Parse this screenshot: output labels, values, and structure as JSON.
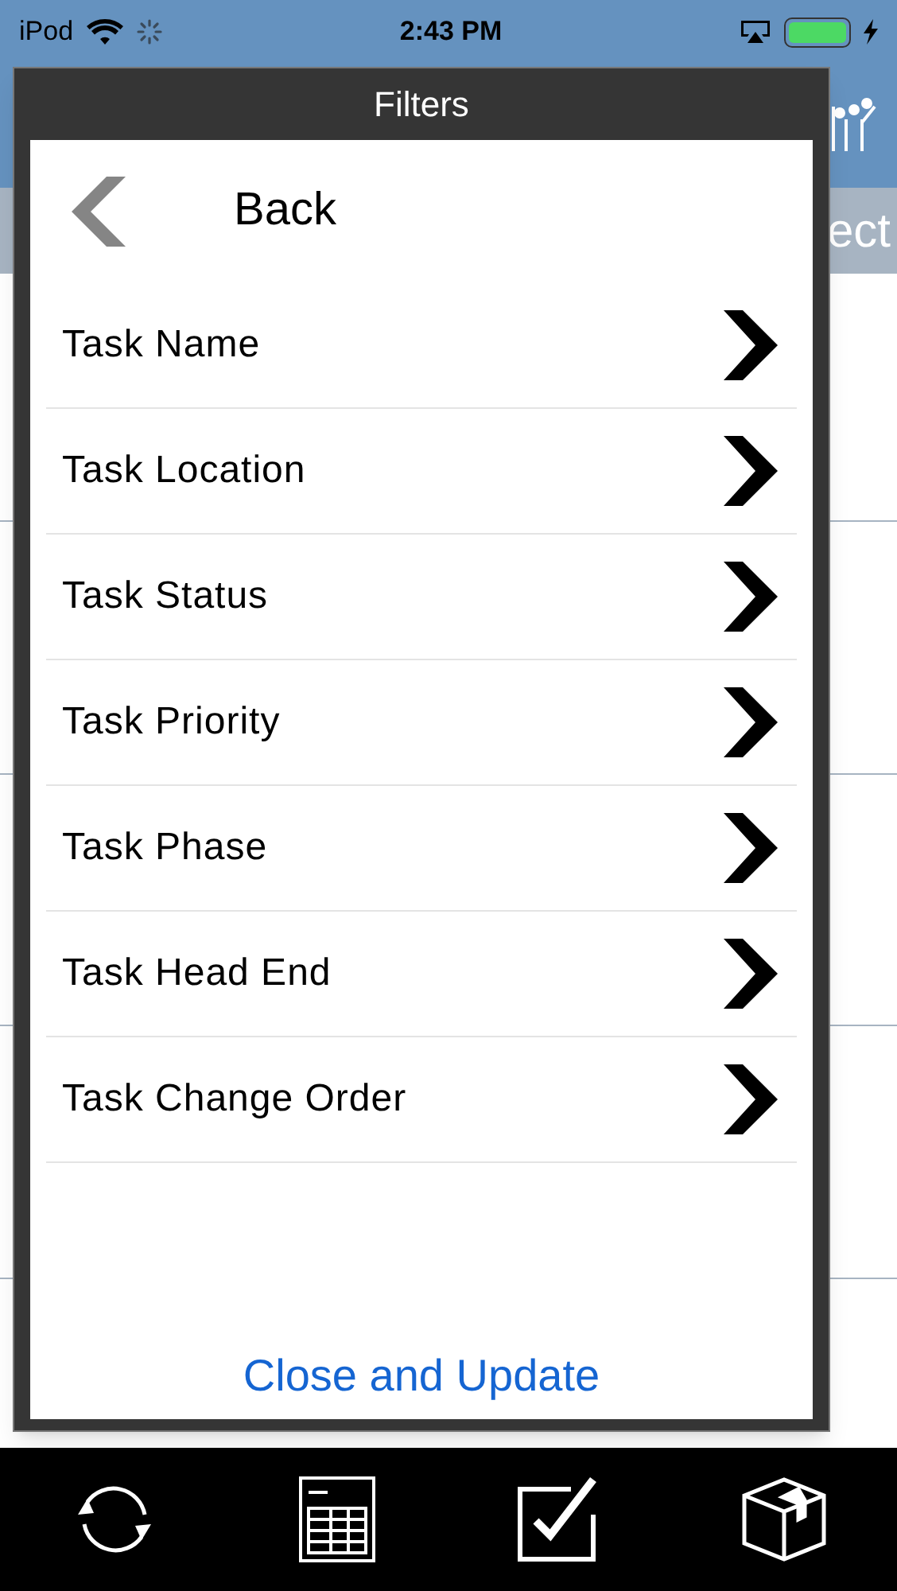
{
  "status_bar": {
    "device": "iPod",
    "time": "2:43 PM"
  },
  "background": {
    "header_partial": "ect"
  },
  "dialog": {
    "title": "Filters",
    "back": "Back",
    "items": [
      {
        "label": "Task Name"
      },
      {
        "label": "Task Location"
      },
      {
        "label": "Task Status"
      },
      {
        "label": "Task Priority"
      },
      {
        "label": "Task Phase"
      },
      {
        "label": "Task Head End"
      },
      {
        "label": "Task Change Order"
      }
    ],
    "action": "Close and Update"
  },
  "toolbar": [
    {
      "kind": "sync"
    },
    {
      "kind": "sheet"
    },
    {
      "kind": "check"
    },
    {
      "kind": "box"
    }
  ]
}
